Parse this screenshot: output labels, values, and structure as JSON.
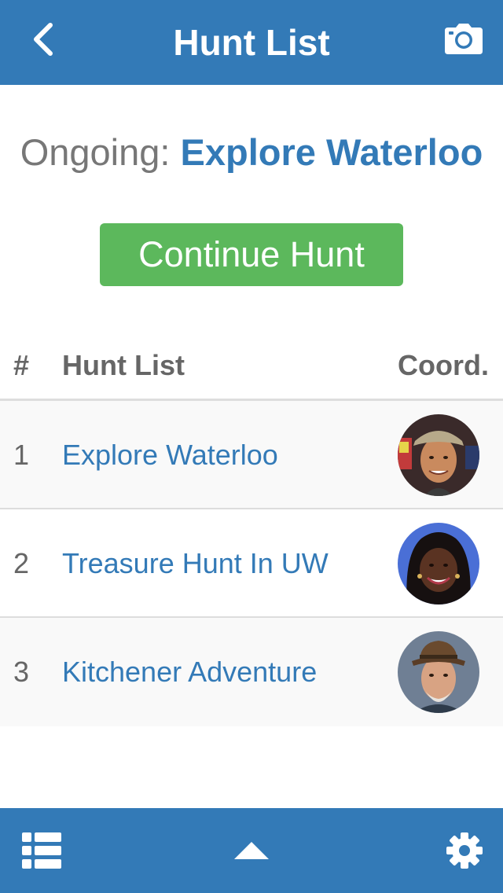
{
  "header": {
    "title": "Hunt List",
    "back_icon": "chevron-left-icon",
    "camera_icon": "camera-icon"
  },
  "ongoing": {
    "label": "Ongoing:",
    "hunt_name": "Explore Waterloo"
  },
  "continue_button": {
    "label": "Continue Hunt"
  },
  "table": {
    "columns": [
      "#",
      "Hunt List",
      "Coord."
    ],
    "rows": [
      {
        "num": "1",
        "name": "Explore Waterloo",
        "avatar": "coordinator-avatar-man-cap"
      },
      {
        "num": "2",
        "name": "Treasure Hunt In UW",
        "avatar": "coordinator-avatar-woman"
      },
      {
        "num": "3",
        "name": "Kitchener Adventure",
        "avatar": "coordinator-avatar-old-man-hat"
      }
    ]
  },
  "tabbar": {
    "items": [
      "list-icon",
      "caret-up-icon",
      "gear-icon"
    ]
  },
  "colors": {
    "primary": "#337ab7",
    "success": "#5cb85c",
    "muted_text": "#777777",
    "header_text": "#666666",
    "divider": "#dddddd",
    "stripe": "#f9f9f9"
  }
}
